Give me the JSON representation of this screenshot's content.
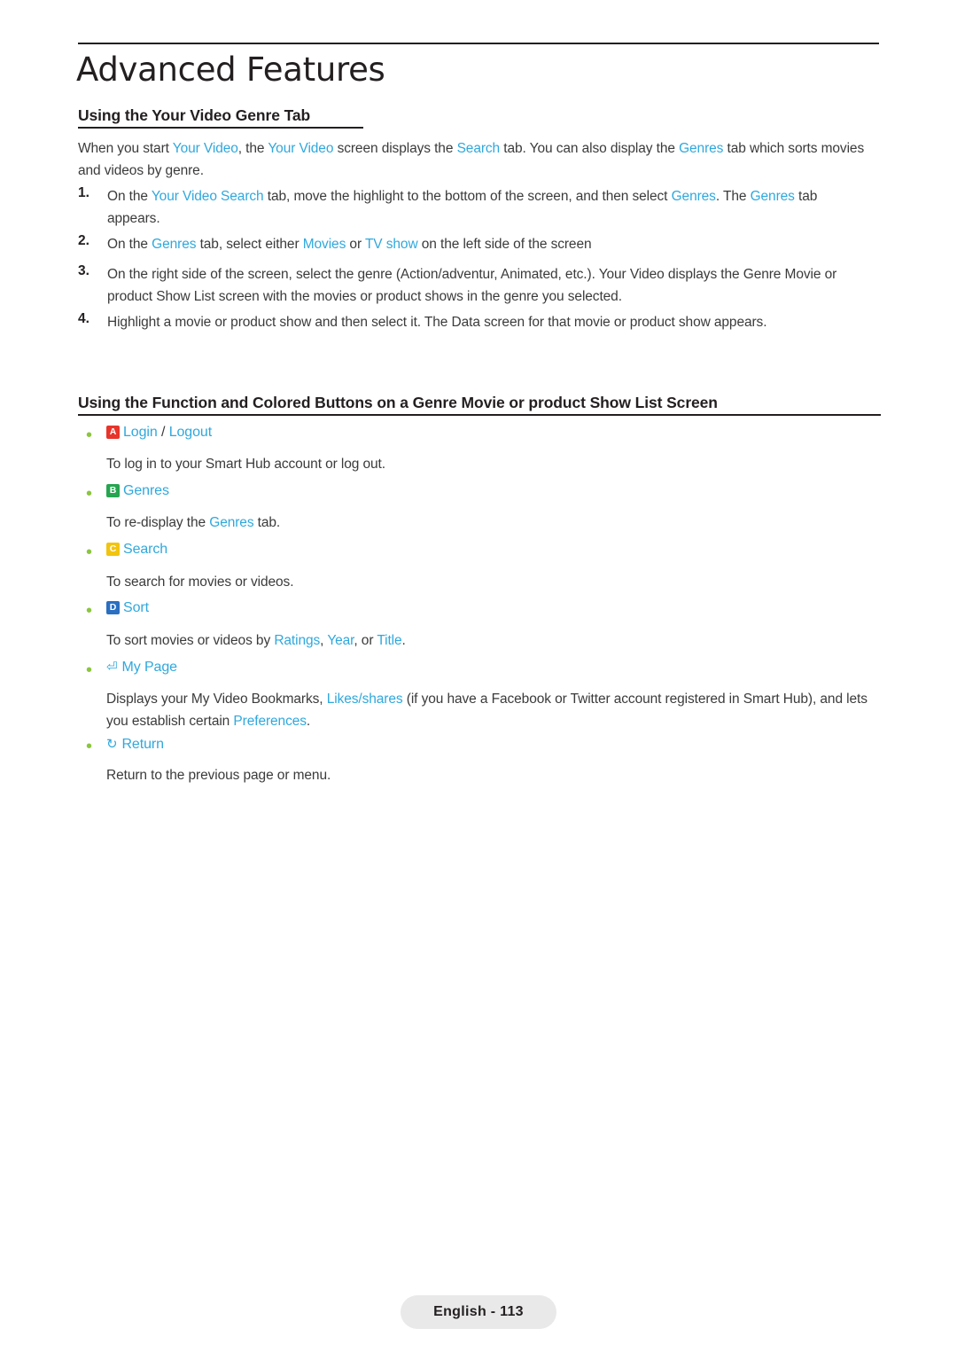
{
  "header": {
    "chapter_title": "Advanced Features"
  },
  "section1": {
    "heading": "Using the Your Video Genre Tab",
    "intro": {
      "p1": "When you start ",
      "l1": "Your Video",
      "p2": ", the ",
      "l2": "Your Video",
      "p3": " screen displays the ",
      "l3": "Search",
      "p4": " tab. You can also display the ",
      "l4": "Genres",
      "p5": " tab which sorts movies and videos by genre."
    },
    "steps": [
      {
        "number": "1.",
        "p1": "On the ",
        "l1": "Your Video Search",
        "p2": " tab, move the highlight to the bottom of the screen, and then select ",
        "l2": "Genres",
        "p3": ". The ",
        "l3": "Genres",
        "p4": " tab appears."
      },
      {
        "number": "2.",
        "p1": "On the ",
        "l1": "Genres",
        "p2": " tab, select either ",
        "l2": "Movies",
        "p3": " or ",
        "l3": "TV show",
        "p4": " on the left side of the screen"
      },
      {
        "number": "3.",
        "p1": "On the right side of the screen, select the genre (Action/adventur, Animated, etc.). Your Video displays the Genre Movie or product Show List screen with the movies or product shows in the genre you selected."
      },
      {
        "number": "4.",
        "p1": "Highlight a movie or product show and then select it. The Data screen for that movie or product show appears."
      }
    ]
  },
  "section2": {
    "heading": "Using the Function and Colored Buttons on a Genre Movie or product Show List Screen",
    "items": [
      {
        "key_type": "cap-a",
        "key_label": "A",
        "label_a": "Login",
        "label_sep": " / ",
        "label_b": "Logout",
        "desc": "To log in to your Smart Hub account or log out."
      },
      {
        "key_type": "cap-b",
        "key_label": "B",
        "label_a": "Genres",
        "desc_p1": "To re-display the ",
        "desc_l1": "Genres",
        "desc_p2": " tab."
      },
      {
        "key_type": "cap-c",
        "key_label": "C",
        "label_a": "Search",
        "desc": "To search for movies or videos."
      },
      {
        "key_type": "cap-d",
        "key_label": "D",
        "label_a": "Sort",
        "desc_p1": "To sort movies or videos by ",
        "desc_l1": "Ratings",
        "desc_p2": ", ",
        "desc_l2": "Year",
        "desc_p3": ", or ",
        "desc_l3": "Title",
        "desc_p4": "."
      },
      {
        "key_type": "glyph-mypage",
        "key_label": "⏎",
        "label_a": "My Page",
        "desc_p1": "Displays your My Video Bookmarks, ",
        "desc_l1": "Likes/shares",
        "desc_p2": " (if you have a Facebook or Twitter account registered in Smart Hub), and lets you establish certain ",
        "desc_l2": "Preferences",
        "desc_p3": "."
      },
      {
        "key_type": "glyph-return",
        "key_label": "↻",
        "label_a": "Return",
        "desc": "Return to the previous page or menu."
      }
    ]
  },
  "footer": {
    "page_label": "English - 113"
  }
}
